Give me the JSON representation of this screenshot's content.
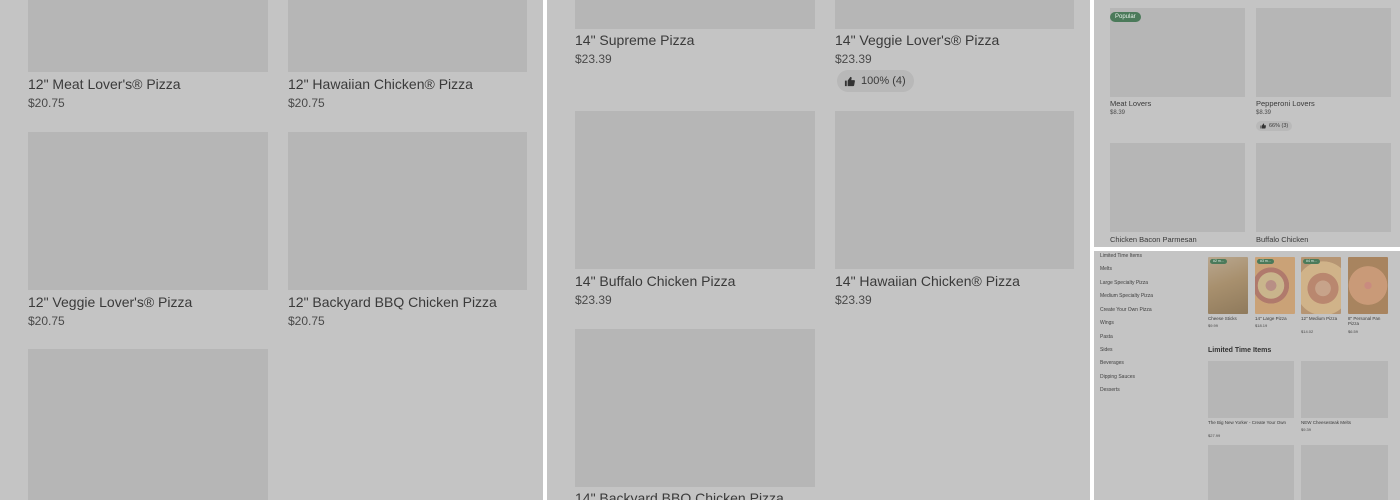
{
  "panel_left": {
    "items": [
      {
        "name": "12\" Meat Lover's® Pizza",
        "price": "$20.75"
      },
      {
        "name": "12\" Hawaiian Chicken® Pizza",
        "price": "$20.75"
      },
      {
        "name": "12\" Veggie Lover's® Pizza",
        "price": "$20.75"
      },
      {
        "name": "12\" Backyard BBQ Chicken Pizza",
        "price": "$20.75"
      }
    ]
  },
  "panel_middle": {
    "items": [
      {
        "name": "14\" Supreme Pizza",
        "price": "$23.39"
      },
      {
        "name": "14\" Veggie Lover's® Pizza",
        "price": "$23.39",
        "rating": "100% (4)"
      },
      {
        "name": "14\" Buffalo Chicken Pizza",
        "price": "$23.39"
      },
      {
        "name": "14\" Hawaiian Chicken® Pizza",
        "price": "$23.39"
      },
      {
        "name": "14\" Backyard BBQ Chicken Pizza",
        "price": ""
      }
    ]
  },
  "panel_top_right": {
    "badge": "Popular",
    "items": [
      {
        "name": "Meat Lovers",
        "price": "$8.39"
      },
      {
        "name": "Pepperoni Lovers",
        "price": "$8.39",
        "rating": "66% (3)"
      },
      {
        "name": "Chicken Bacon Parmesan",
        "price": ""
      },
      {
        "name": "Buffalo Chicken",
        "price": ""
      }
    ]
  },
  "panel_bottom_right": {
    "categories": [
      "Limited Time Items",
      "Melts",
      "Large Specialty Pizza",
      "Medium Specialty Pizza",
      "Create Your Own Pizza",
      "Wings",
      "Pasta",
      "Sides",
      "Beverages",
      "Dipping Sauces",
      "Desserts"
    ],
    "featured": [
      {
        "name": "Cheese Sticks",
        "price": "$9.99",
        "badge": "#2 m..."
      },
      {
        "name": "14\" Large Pizza",
        "price": "$18.19",
        "badge": "#3 m..."
      },
      {
        "name": "12\" Medium Pizza",
        "price": "$14.02",
        "badge": "#4 m..."
      },
      {
        "name": "8\" Personal Pan Pizza",
        "price": "$6.59",
        "badge": ""
      }
    ],
    "section_title": "Limited Time Items",
    "limited": [
      {
        "name": "The Big New Yorker - Create Your Own",
        "price": "$27.99"
      },
      {
        "name": "NEW Cheesesteak Melts",
        "price": "$9.39"
      }
    ]
  },
  "colors": {
    "overlay": "#c4c4c4",
    "placeholder": "#b6b6b6",
    "badge_green": "#4b7a5a"
  }
}
